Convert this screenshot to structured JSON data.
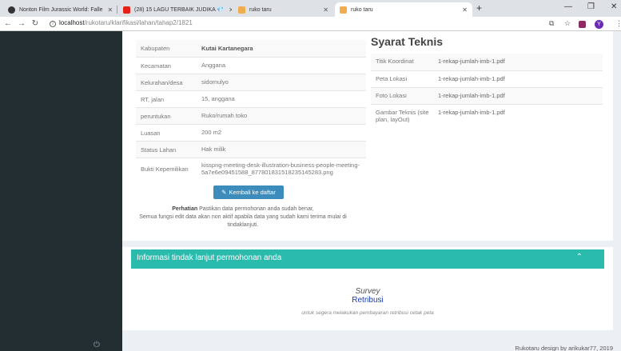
{
  "browser": {
    "tabs": [
      {
        "title": "Nonton Film Jurassic World: Falle"
      },
      {
        "title": "(28) 15 LAGU TERBAIK JUDIKA 💎"
      },
      {
        "title": "ruko taru"
      },
      {
        "title": "ruko taru"
      }
    ],
    "new_tab": "+",
    "url_host": "localhost",
    "url_path": "/rukotaru/klarifikasi/lahan/tahap2/1821",
    "profile_initial": "Y"
  },
  "left_table": [
    {
      "label": "Kabupaten",
      "value": "Kutai Kartanegara",
      "strong": true
    },
    {
      "label": "Kecamatan",
      "value": "Anggana"
    },
    {
      "label": "Kelurahan/desa",
      "value": "sidomulyo"
    },
    {
      "label": "RT, jalan",
      "value": "15, anggana"
    },
    {
      "label": "peruntukan",
      "value": "Ruko/rumah toko"
    },
    {
      "label": "Luasan",
      "value": "200 m2"
    },
    {
      "label": "Status Lahan",
      "value": "Hak milik"
    },
    {
      "label": "Bukti Kepemilikan",
      "value": "kisspng-meeting-desk-illustration-business-people-meeting-5a7e6e09451588_8778018315182351452​83.png"
    }
  ],
  "back_button": "Kembali ke daftar",
  "notice": {
    "strong": "Perhatian",
    "text1": "Pastikan data permohonan anda sudah benar,",
    "text2": "Semua fungsi edit data akan non aktif apabila data yang sudah kami terima mulai di tindaklanjuti."
  },
  "syarat": {
    "title": "Syarat Teknis",
    "rows": [
      {
        "label": "Titik Koordinat",
        "value": "1-rekap-jumlah-imb-1.pdf"
      },
      {
        "label": "Peta Lokasi",
        "value": "1-rekap-jumlah-imb-1.pdf"
      },
      {
        "label": "Foto Lokasi",
        "value": "1-rekap-jumlah-imb-1.pdf"
      },
      {
        "label": "Gambar Teknis (site plan, layOut)",
        "value": "1-rekap-jumlah-imb-1.pdf"
      }
    ]
  },
  "followup": {
    "title": "Informasi tindak lanjut permohonan anda",
    "survey": "Survey",
    "retribusi": "Retribusi",
    "hint": "untuk segera melakukan pembayaran retribusi cetak peta"
  },
  "footer": "Rukotaru design by arikukar77, 2019",
  "colors": {
    "sidebar": "#222d32",
    "primary": "#3c8dbc",
    "teal": "#2bbbad",
    "bg": "#ecf0f5"
  }
}
